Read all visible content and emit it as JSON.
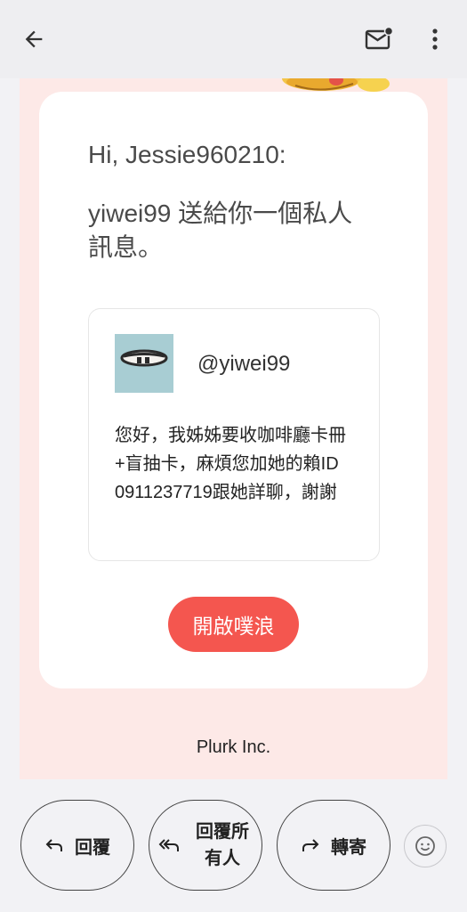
{
  "greeting": "Hi, Jessie960210:",
  "intro": "yiwei99 送給你一個私人訊息。",
  "sender": {
    "username": "@yiwei99",
    "message": "您好，我姊姊要收咖啡廳卡冊+盲抽卡，麻煩您加她的賴ID 0911237719跟她詳聊，謝謝"
  },
  "open_button": "開啟噗浪",
  "footer": "Plurk Inc.",
  "actions": {
    "reply": "回覆",
    "reply_all": "回覆所有人",
    "forward": "轉寄"
  },
  "colors": {
    "accent": "#f4564f",
    "email_background": "#fde9e7",
    "avatar_background": "#a8cdd3"
  },
  "icons": {
    "back": "back-arrow-icon",
    "mail": "mail-unread-icon",
    "more": "more-vert-icon",
    "reply": "reply-icon",
    "reply_all": "reply-all-icon",
    "forward": "forward-icon",
    "emoji": "emoji-icon"
  }
}
